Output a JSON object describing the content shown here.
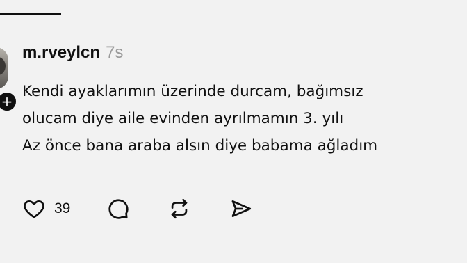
{
  "post": {
    "username": "m.rveylcn",
    "timestamp": "7s",
    "lines": [
      "Kendi ayaklarımın üzerinde durcam, bağımsız",
      "olucam diye aile evinden ayrılmamın 3. yılı",
      "Az önce bana araba alsın diye babama ağladım"
    ],
    "follow_glyph": "+",
    "actions": {
      "like_count": "39",
      "like_icon": "heart-icon",
      "reply_icon": "comment-icon",
      "repost_icon": "repost-icon",
      "share_icon": "send-icon"
    }
  },
  "colors": {
    "background": "#f2f2f2",
    "text": "#101010",
    "muted": "#9a9a9a",
    "divider": "#dcdcdc"
  }
}
